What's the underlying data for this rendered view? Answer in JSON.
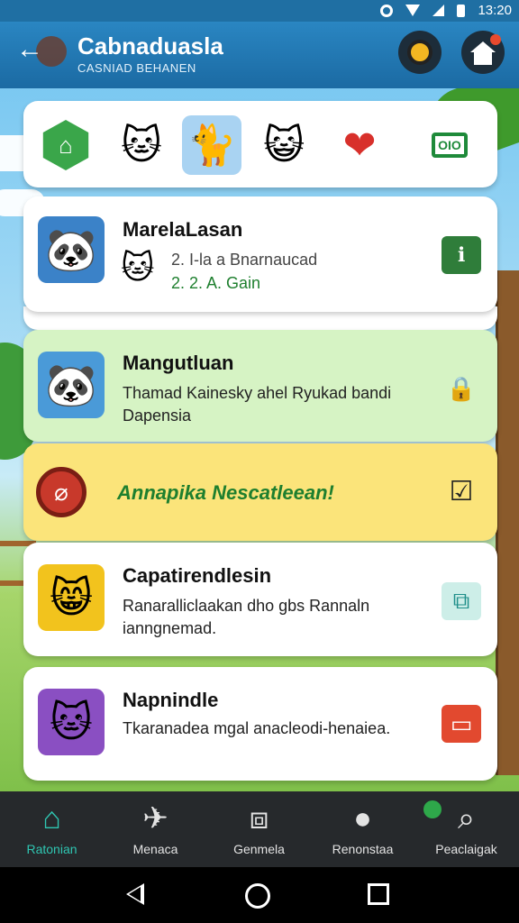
{
  "status_bar": {
    "time": "13:20"
  },
  "header": {
    "title": "Cabnaduasla",
    "subtitle": "CASNIAD BEHANEN",
    "back_icon": "back-arrow-icon",
    "coin_icon": "coin-icon",
    "home_icon": "home-icon"
  },
  "icon_strip": {
    "items": [
      {
        "icon": "home-hexagon-icon",
        "glyph": "⌂"
      },
      {
        "icon": "cat-face-icon",
        "glyph": "🐱"
      },
      {
        "icon": "gray-cat-icon",
        "glyph": "🐈",
        "selected": true
      },
      {
        "icon": "orange-cat-icon",
        "glyph": "😺"
      },
      {
        "icon": "heart-icon",
        "glyph": "❤"
      },
      {
        "icon": "gift-card-icon",
        "glyph": "OIO"
      }
    ]
  },
  "cards": [
    {
      "title": "MarelaLasan",
      "line1": "2. I-la a Bnarnaucad",
      "line2": "2. 2. A. Gain",
      "avatar": "🐼",
      "small_avatar": "🐱",
      "action_icon": "info-icon",
      "action_glyph": "ℹ",
      "action_color": "#2f7d3a"
    },
    {
      "title": "Mangutluan",
      "text": "Thamad Kainesky ahel Ryukad bandi Dapensia",
      "avatar": "🐼",
      "action_icon": "lock-bag-icon",
      "action_glyph": "🔒",
      "action_color": "#d8344a"
    },
    {
      "banner": "Annapika Nescatleean!",
      "action_icon": "checkbox-icon",
      "action_glyph": "☑"
    },
    {
      "title": "Capatirendlesin",
      "text": "Ranaralliclaakan dho gbs Rannaln ianngnemad.",
      "avatar": "😸",
      "action_icon": "puzzle-icon",
      "action_glyph": "⧉",
      "action_color": "#1f8f8a"
    },
    {
      "title": "Napnindle",
      "text": "Tkaranadea mgal anacleodi-henaiea.",
      "avatar": "🐱",
      "action_icon": "card-icon",
      "action_glyph": "▭",
      "action_color": "#e2492f"
    }
  ],
  "bottom_nav": {
    "items": [
      {
        "label": "Ratonian",
        "icon": "home-icon",
        "glyph": "⌂",
        "active": true
      },
      {
        "label": "Menaca",
        "icon": "paper-plane-icon",
        "glyph": "✈"
      },
      {
        "label": "Genmela",
        "icon": "cards-icon",
        "glyph": "⧈"
      },
      {
        "label": "Renonstaa",
        "icon": "pin-icon",
        "glyph": "●"
      },
      {
        "label": "Peaclaigak",
        "icon": "search-icon",
        "glyph": "⌕"
      }
    ]
  },
  "colors": {
    "header": "#1b6aa3",
    "accent": "#2fc6b2",
    "card_green": "#d6f3c4",
    "card_yellow": "#fbe47a"
  }
}
